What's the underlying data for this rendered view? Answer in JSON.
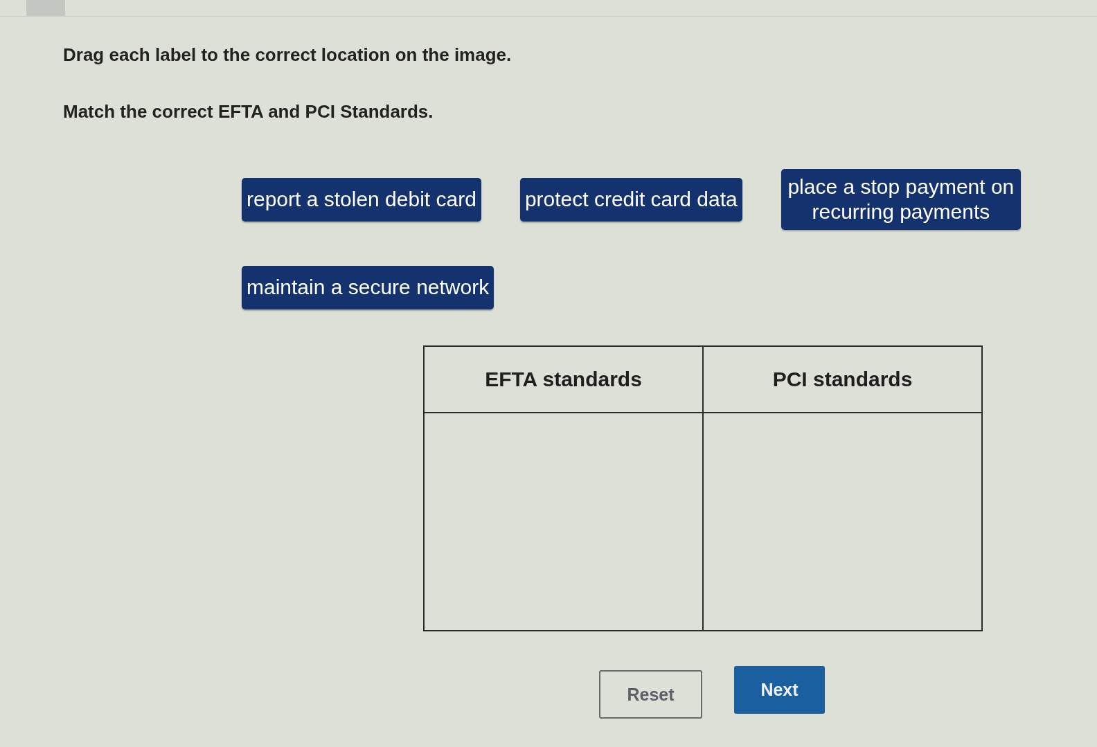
{
  "instructions": [
    "Drag each label to the correct location on the image.",
    "Match the correct EFTA and PCI Standards."
  ],
  "label_rows": [
    [
      "report a stolen debit card",
      "protect credit card data",
      "place a stop payment on recurring payments"
    ],
    [
      "maintain a secure network"
    ]
  ],
  "table": {
    "columns": [
      "EFTA standards",
      "PCI standards"
    ]
  },
  "buttons": [
    {
      "label": "Reset",
      "kind": "secondary"
    },
    {
      "label": "Next",
      "kind": "primary"
    }
  ]
}
